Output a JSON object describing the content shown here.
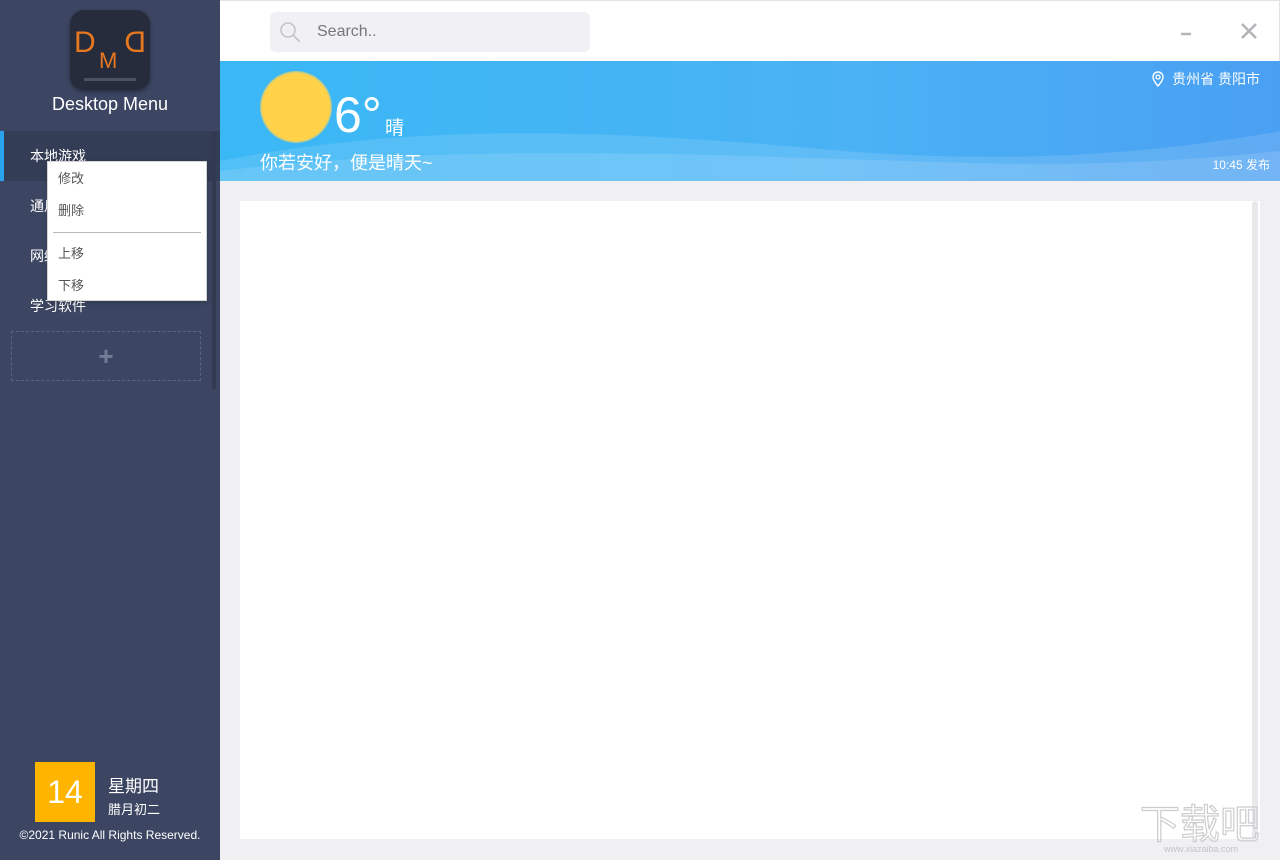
{
  "app": {
    "title": "Desktop Menu",
    "logo_letters": [
      "D",
      "M",
      "D"
    ],
    "accent_color": "#2aa3ef",
    "logo_letter_color": "#e8781e"
  },
  "sidebar": {
    "items": [
      {
        "label": "本地游戏",
        "active": true
      },
      {
        "label": "通用软件",
        "active": false
      },
      {
        "label": "网络工具",
        "active": false
      },
      {
        "label": "学习软件",
        "active": false
      }
    ],
    "add_label": "+"
  },
  "context_menu": {
    "items": [
      "修改",
      "删除",
      "上移",
      "下移"
    ]
  },
  "date": {
    "day": "14",
    "weekday": "星期四",
    "lunar": "腊月初二"
  },
  "footer": {
    "copyright": "©2021 Runic All Rights Reserved."
  },
  "search": {
    "placeholder": "Search..",
    "icon": "search-icon"
  },
  "window": {
    "minimize_icon": "minimize-icon",
    "close_icon": "close-icon"
  },
  "weather": {
    "temperature": "6°",
    "condition": "晴",
    "motto": "你若安好，便是晴天~",
    "location": "贵州省 贵阳市",
    "published": "10:45 发布",
    "icon": "sun-icon"
  },
  "watermark": {
    "text": "下载吧",
    "url_text": "www.xiazaiba.com"
  }
}
